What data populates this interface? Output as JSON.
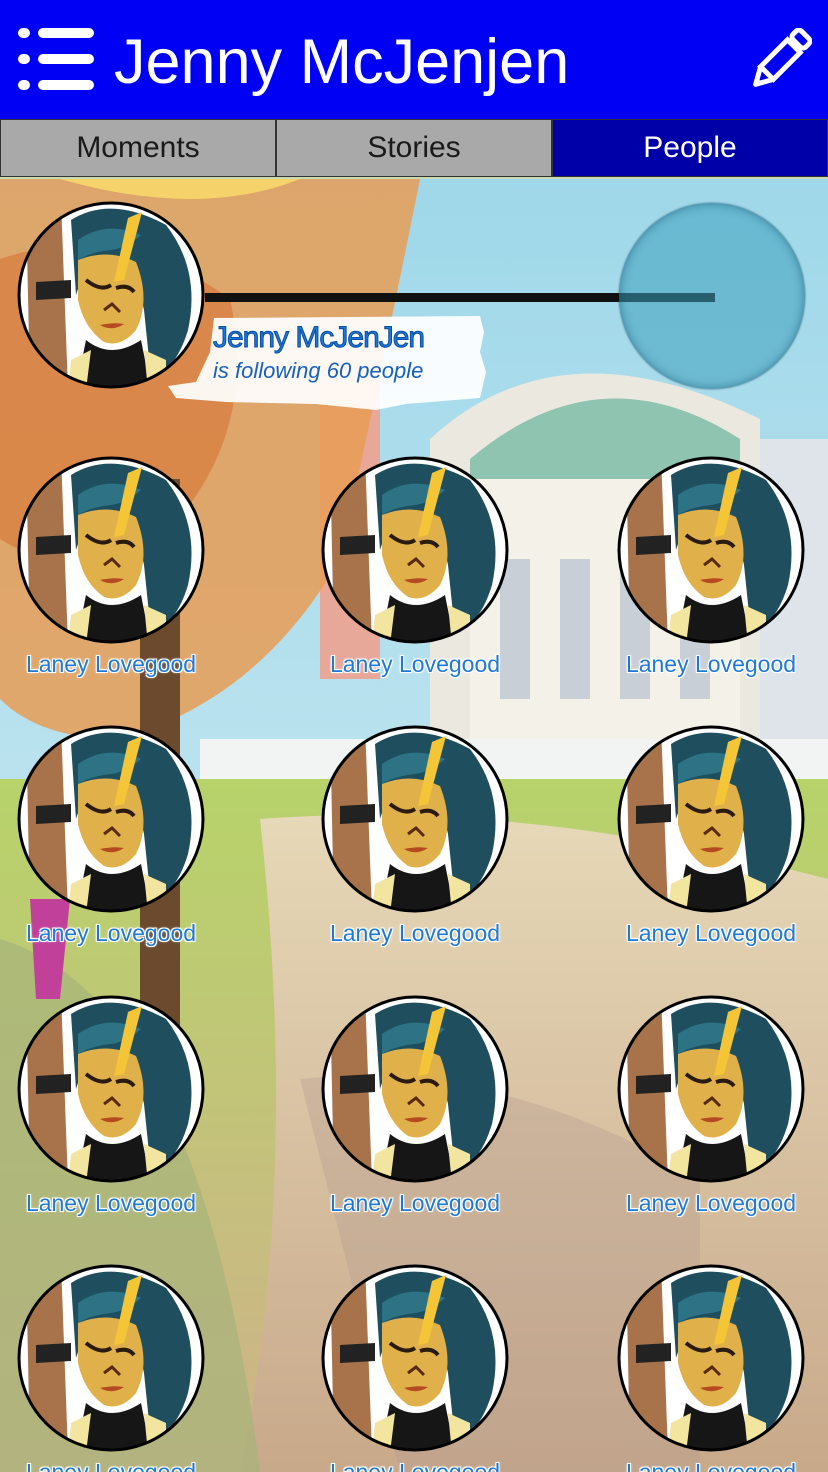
{
  "header": {
    "title": "Jenny McJenjen",
    "menu_icon": "list-menu-icon",
    "edit_icon": "pencil-icon",
    "background_color": "#0000f5"
  },
  "tabs": [
    {
      "label": "Moments",
      "active": false
    },
    {
      "label": "Stories",
      "active": false
    },
    {
      "label": "People",
      "active": true
    }
  ],
  "profile": {
    "name": "Jenny McJenJen",
    "subtitle": "is following 60 people"
  },
  "people": [
    {
      "name": "Laney Lovegood"
    },
    {
      "name": "Laney Lovegood"
    },
    {
      "name": "Laney Lovegood"
    },
    {
      "name": "Laney Lovegood"
    },
    {
      "name": "Laney Lovegood"
    },
    {
      "name": "Laney Lovegood"
    },
    {
      "name": "Laney Lovegood"
    },
    {
      "name": "Laney Lovegood"
    },
    {
      "name": "Laney Lovegood"
    },
    {
      "name": "Laney Lovegood"
    },
    {
      "name": "Laney Lovegood"
    },
    {
      "name": "Laney Lovegood"
    }
  ],
  "colors": {
    "accent": "#0000f5",
    "active_tab": "#0000a8",
    "inactive_tab": "#a9a9a9",
    "name_text": "#1e78d8"
  }
}
